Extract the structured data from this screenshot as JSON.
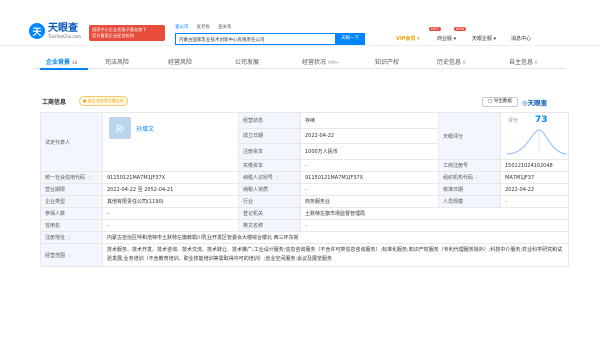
{
  "header": {
    "logo_mark": "天",
    "logo_name": "天眼查",
    "logo_url": "TianYanCha.com",
    "official_badge_line1": "国家中小企业发展子基金旗下",
    "official_badge_line2": "官方备案企业征信机构",
    "search_tabs": [
      "查公司",
      "查老板",
      "查关系"
    ],
    "search_value": "内蒙古国家乳业技术创新中心有限责任公司",
    "search_button": "天眼一下",
    "vip_label": "VIP会员 ▾",
    "vip_hot": "HOT",
    "nav": [
      "商业版 ▾",
      "天眼企服 ▾",
      "消息中心"
    ],
    "nav_hot": "NEW"
  },
  "tabs": [
    {
      "label": "企业背景",
      "count": "16"
    },
    {
      "label": "司法风险",
      "count": ""
    },
    {
      "label": "经营风险",
      "count": ""
    },
    {
      "label": "公司发展",
      "count": ""
    },
    {
      "label": "经营状况",
      "count": "999+"
    },
    {
      "label": "知识产权",
      "count": ""
    },
    {
      "label": "历史信息",
      "count": "8"
    },
    {
      "label": "自主信息",
      "count": "6"
    }
  ],
  "card": {
    "title": "工商信息",
    "tag": "● 该企业信息可能过时",
    "share": "□ 导出数据",
    "brand": "◎天眼查"
  },
  "info": {
    "legal_rep_label": "法定代表人",
    "avatar_char": "孙",
    "rep_name": "孙增文",
    "status_label": "经营状态",
    "status_value": "存续",
    "est_date_label": "成立日期",
    "est_date_value": "2022-04-22",
    "reg_capital_label": "注册资本",
    "reg_capital_value": "1000万人民币",
    "paid_capital_label": "实缴资本",
    "paid_capital_value": "-",
    "score_label": "天眼评分",
    "score_title": "评分",
    "score_value": "73",
    "reg_no_label": "工商注册号",
    "reg_no_value": "150121024102048",
    "credit_code_label": "统一社会信用代码",
    "credit_code_value": "91150121MA7M1JF37X",
    "taxpayer_id_label": "纳税人识别号",
    "taxpayer_id_value": "91150121MA7M1JF37X",
    "org_code_label": "组织机构代码",
    "org_code_value": "MA7M1JF37",
    "term_label": "营业期限",
    "term_value": "2022-04-22 至 2052-04-21",
    "taxpayer_qual_label": "纳税人资质",
    "taxpayer_qual_value": "-",
    "approval_date_label": "核准日期",
    "approval_date_value": "2022-04-22",
    "company_type_label": "企业类型",
    "company_type_value": "其他有限责任公司(1190)",
    "industry_label": "行业",
    "industry_value": "商务服务业",
    "staff_label": "人员规模",
    "staff_value": "-",
    "insured_label": "参保人数",
    "insured_value": "-",
    "authority_label": "登记机关",
    "authority_value": "土默特左旗市场监督管理局",
    "former_name_label": "曾用名",
    "former_name_value": "-",
    "english_name_label": "英文名称",
    "english_name_value": "-",
    "address_label": "注册地址",
    "address_value": "内蒙古自治区呼和浩特市土默特左旗敕勒川乳业开发区管委会大楼综合楼北 西三环东街",
    "scope_label": "经营范围",
    "scope_value": "技术服务、技术开发、技术咨询、技术交流、技术转让、技术推广;工业设计服务;信息咨询服务（不含许可类信息咨询服务）;标准化服务;知识产权服务（专利代理服务除外）;科技中介服务;农业科学研究和试验发展;业务培训（不含教育培训、职业技能培训等需取得许可的培训）;创业空间服务;会议及展览服务"
  }
}
